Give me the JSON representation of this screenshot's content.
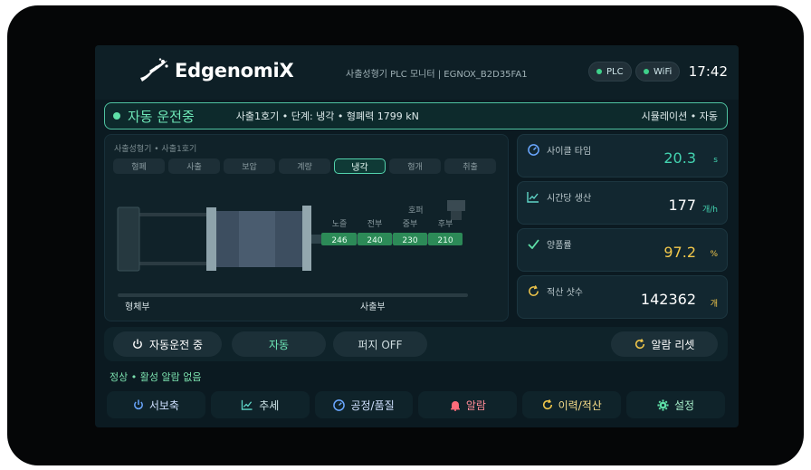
{
  "header": {
    "logo_text": "EdgenomiX",
    "subtitle": "사출성형기 PLC 모니터  |  EGNOX_B2D35FA1",
    "pills": [
      "PLC",
      "WiFi"
    ],
    "clock": "17:42"
  },
  "banner": {
    "state": "자동 운전중",
    "detail": "사출1호기 • 단계: 냉각 • 형폐력 1799 kN",
    "mode": "시뮬레이션 • 자동"
  },
  "machine": {
    "breadcrumb": "사출성형기 • 사출1호기",
    "stages": [
      "형폐",
      "사출",
      "보압",
      "계량",
      "냉각",
      "형개",
      "취출"
    ],
    "active_stage": "냉각",
    "hopper_label": "호퍼",
    "zones": [
      {
        "name": "노즐",
        "temp": "246"
      },
      {
        "name": "전부",
        "temp": "240"
      },
      {
        "name": "중부",
        "temp": "230"
      },
      {
        "name": "후부",
        "temp": "210"
      }
    ],
    "clamp_label": "형체부",
    "inject_label": "사출부"
  },
  "metrics": [
    {
      "label": "사이클 타임",
      "value": "20.3",
      "unit": "s",
      "icon": "gauge-icon",
      "color": "#43d3b0"
    },
    {
      "label": "시간당 생산",
      "value": "177",
      "unit": "개/h",
      "icon": "chart-line-icon",
      "color": "#ffffff"
    },
    {
      "label": "양품률",
      "value": "97.2",
      "unit": "%",
      "icon": "check-icon",
      "color": "#f2c84b"
    },
    {
      "label": "적산 샷수",
      "value": "142362",
      "unit": "개",
      "icon": "refresh-icon",
      "color": "#ffffff"
    }
  ],
  "controls": {
    "auto_run": "자동운전 중",
    "mode": "자동",
    "purge": "퍼지 OFF",
    "alarm_reset": "알람 리셋"
  },
  "status_line": "정상 • 활성 알람 없음",
  "nav": [
    {
      "label": "서보축",
      "icon": "power-icon",
      "color": "#6aa7ff"
    },
    {
      "label": "추세",
      "icon": "chart-line-icon",
      "color": "#5fd6c8"
    },
    {
      "label": "공정/품질",
      "icon": "gauge-icon",
      "color": "#6aa7ff"
    },
    {
      "label": "알람",
      "icon": "bell-icon",
      "color": "#ff6b7a"
    },
    {
      "label": "이력/적산",
      "icon": "refresh-icon",
      "color": "#f2c84b"
    },
    {
      "label": "설정",
      "icon": "gear-icon",
      "color": "#5fe0a8"
    }
  ]
}
